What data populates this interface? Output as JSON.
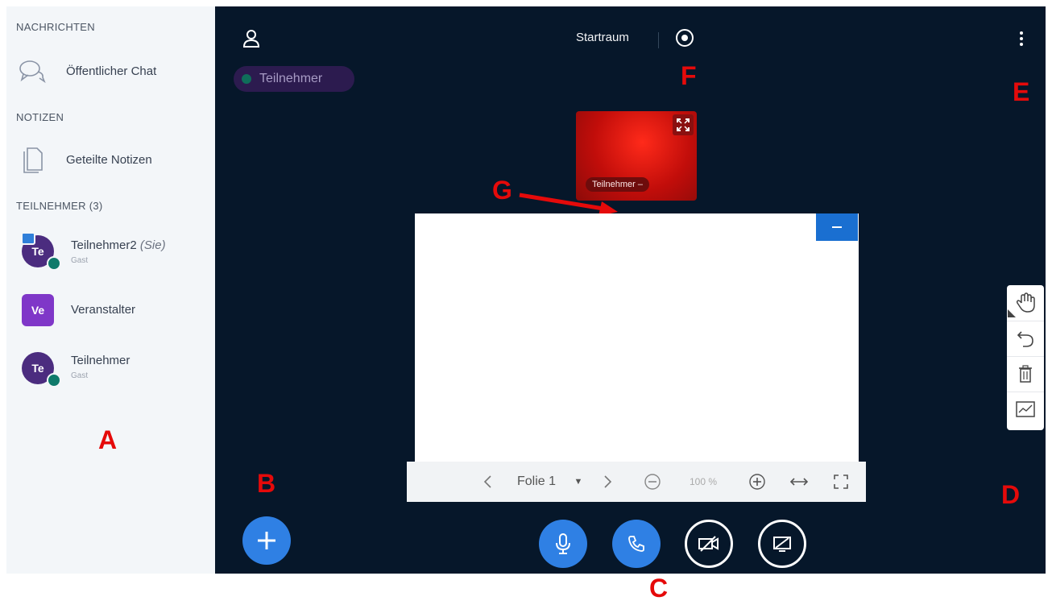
{
  "sidebar": {
    "messages_title": "NACHRICHTEN",
    "public_chat": "Öffentlicher Chat",
    "notes_title": "NOTIZEN",
    "shared_notes": "Geteilte Notizen",
    "participants_title": "TEILNEHMER (3)",
    "users": [
      {
        "initials": "Te",
        "name": "Teilnehmer2",
        "you": "(Sie)",
        "role": "Gast"
      },
      {
        "initials": "Ve",
        "name": "Veranstalter",
        "role": ""
      },
      {
        "initials": "Te",
        "name": "Teilnehmer",
        "role": "Gast"
      }
    ]
  },
  "header": {
    "room": "Startraum",
    "talking_indicator": "Teilnehmer"
  },
  "webcam": {
    "label": "Teilnehmer –"
  },
  "presentation": {
    "slide_label": "Folie 1",
    "dropdown_caret": "▼",
    "zoom": "100 %"
  },
  "markers": {
    "A": "A",
    "B": "B",
    "C": "C",
    "D": "D",
    "E": "E",
    "F": "F",
    "G": "G"
  },
  "colors": {
    "main_bg": "#06172a",
    "sidebar_bg": "#f3f6f9",
    "primary": "#2f80e4",
    "marker": "#e50a0a"
  },
  "icons": [
    "user-icon",
    "record-icon",
    "kebab-menu-icon",
    "chat-icon",
    "notes-icon",
    "expand-icon",
    "minimize-icon",
    "hand-icon",
    "undo-icon",
    "trash-icon",
    "multiuser-icon",
    "plus-icon",
    "microphone-icon",
    "phone-icon",
    "camera-off-icon",
    "screenshare-off-icon"
  ]
}
